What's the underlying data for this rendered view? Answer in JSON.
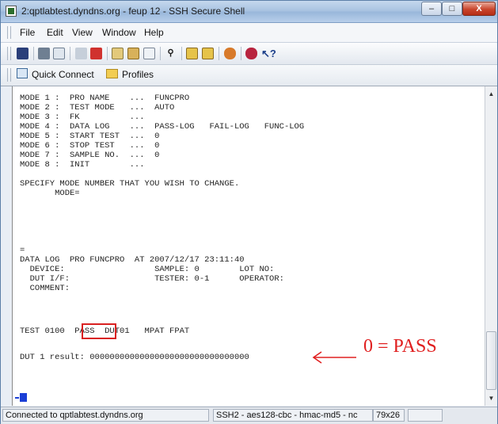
{
  "window": {
    "title": "2:qptlabtest.dyndns.org - feup 12 - SSH Secure Shell"
  },
  "controls": {
    "minimize": "–",
    "maximize": "□",
    "close": "X"
  },
  "menu": [
    {
      "label": "File"
    },
    {
      "label": "Edit"
    },
    {
      "label": "View"
    },
    {
      "label": "Window"
    },
    {
      "label": "Help"
    }
  ],
  "toolbar_icons": [
    "save-icon",
    "print-icon",
    "print-preview-icon",
    "new-file-transfer-icon",
    "disconnect-icon",
    "copy-icon",
    "paste-icon",
    "paste-special-icon",
    "find-icon",
    "settings-icon",
    "profile-icon",
    "file-transfer-icon",
    "key-icon",
    "help-icon"
  ],
  "quickbar": {
    "quick_connect": "Quick Connect",
    "profiles": "Profiles"
  },
  "terminal": {
    "lines": [
      "MODE 1 :  PRO NAME    ...  FUNCPRO",
      "MODE 2 :  TEST MODE   ...  AUTO",
      "MODE 3 :  FK          ...",
      "MODE 4 :  DATA LOG    ...  PASS-LOG   FAIL-LOG   FUNC-LOG",
      "MODE 5 :  START TEST  ...  0",
      "MODE 6 :  STOP TEST   ...  0",
      "MODE 7 :  SAMPLE NO.  ...  0",
      "MODE 8 :  INIT        ...",
      "",
      "SPECIFY MODE NUMBER THAT YOU WISH TO CHANGE.",
      "       MODE=",
      "",
      "",
      "=",
      "DATA LOG  PRO FUNCPRO  AT 2007/12/17 23:11:40",
      "  DEVICE:                  SAMPLE: 0        LOT NO:",
      "  DUT I/F:                 TESTER: 0-1      OPERATOR:",
      "  COMMENT:",
      "",
      "",
      "TEST 0100  PASS  DUT01   MPAT FPAT",
      "",
      "DUT 1 result: 00000000000000000000000000000000"
    ],
    "annotation": "0 = PASS"
  },
  "status": {
    "connection": "Connected to qptlabtest.dyndns.org",
    "cipher": "SSH2 - aes128-cbc - hmac-md5 - nc",
    "size": "79x26"
  },
  "colors": {
    "annotation": "#e02020",
    "cursor": "#1b3fd6"
  }
}
